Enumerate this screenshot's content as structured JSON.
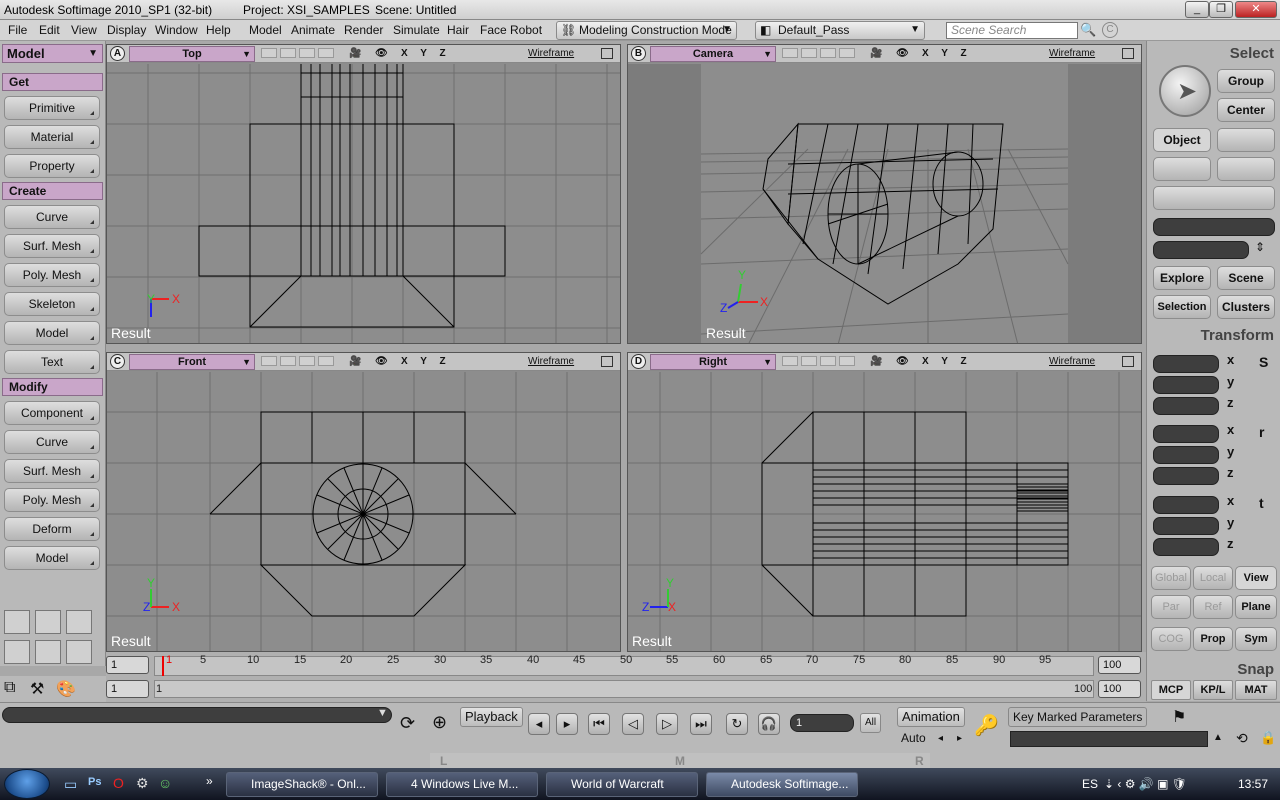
{
  "window": {
    "title": "Autodesk Softimage 2010_SP1 (32-bit)",
    "project": "Project: XSI_SAMPLES",
    "scene": "Scene: Untitled"
  },
  "menu": {
    "items": [
      "File",
      "Edit",
      "View",
      "Display",
      "Window",
      "Help",
      "Model",
      "Animate",
      "Render",
      "Simulate",
      "Hair",
      "Face Robot"
    ],
    "construction_mode": "Modeling Construction Mode",
    "render_pass": "Default_Pass",
    "search_placeholder": "Scene Search"
  },
  "left_panel": {
    "module": "Model",
    "sections": [
      {
        "title": "Get",
        "buttons": [
          "Primitive",
          "Material",
          "Property"
        ]
      },
      {
        "title": "Create",
        "buttons": [
          "Curve",
          "Surf. Mesh",
          "Poly. Mesh",
          "Skeleton",
          "Model",
          "Text"
        ]
      },
      {
        "title": "Modify",
        "buttons": [
          "Component",
          "Curve",
          "Surf. Mesh",
          "Poly. Mesh",
          "Deform",
          "Model"
        ]
      }
    ]
  },
  "viewports": [
    {
      "letter": "A",
      "camera": "Top",
      "axes": "X Y Z",
      "mode": "Wireframe",
      "label": "Result"
    },
    {
      "letter": "B",
      "camera": "Camera",
      "axes": "X Y Z",
      "mode": "Wireframe",
      "label": "Result"
    },
    {
      "letter": "C",
      "camera": "Front",
      "axes": "X Y Z",
      "mode": "Wireframe",
      "label": "Result"
    },
    {
      "letter": "D",
      "camera": "Right",
      "axes": "X Y Z",
      "mode": "Wireframe",
      "label": "Result"
    }
  ],
  "right_panel": {
    "select_title": "Select",
    "select_buttons": {
      "group": "Group",
      "center": "Center",
      "object": "Object"
    },
    "explore_buttons": {
      "explore": "Explore",
      "scene": "Scene",
      "selection": "Selection",
      "clusters": "Clusters"
    },
    "transform_title": "Transform",
    "axes": [
      "x",
      "y",
      "z"
    ],
    "transform_icons": [
      "S",
      "r",
      "t"
    ],
    "ref_buttons": {
      "global": "Global",
      "local": "Local",
      "view": "View",
      "par": "Par",
      "ref": "Ref",
      "plane": "Plane",
      "cog": "COG",
      "prop": "Prop",
      "sym": "Sym"
    },
    "snap_title": "Snap",
    "snap_tabs": [
      "MCP",
      "KP/L",
      "MAT"
    ]
  },
  "timeline": {
    "start_frame": "1",
    "current_marker": "1",
    "end_frame": "100",
    "range_start": "1",
    "range_left_label": "1",
    "range_end_label": "100",
    "range_end": "100",
    "ticks": [
      "5",
      "10",
      "15",
      "20",
      "25",
      "30",
      "35",
      "40",
      "45",
      "50",
      "55",
      "60",
      "65",
      "70",
      "75",
      "80",
      "85",
      "90",
      "95"
    ]
  },
  "bottom_bar": {
    "playback": "Playback",
    "frame_value": "1",
    "all": "All",
    "animation": "Animation",
    "auto": "Auto",
    "key_marked": "Key Marked Parameters",
    "mouse_labels": [
      "L",
      "M",
      "R"
    ]
  },
  "taskbar": {
    "tasks": [
      "ImageShack® - Onl...",
      "4 Windows Live M...",
      "World of Warcraft",
      "Autodesk Softimage..."
    ],
    "language": "ES",
    "clock": "13:57"
  },
  "colors": {
    "accent_purple": "#c9a6c9",
    "viewport_bg": "#8d8d8d",
    "panel_bg": "#b9b9b9"
  }
}
